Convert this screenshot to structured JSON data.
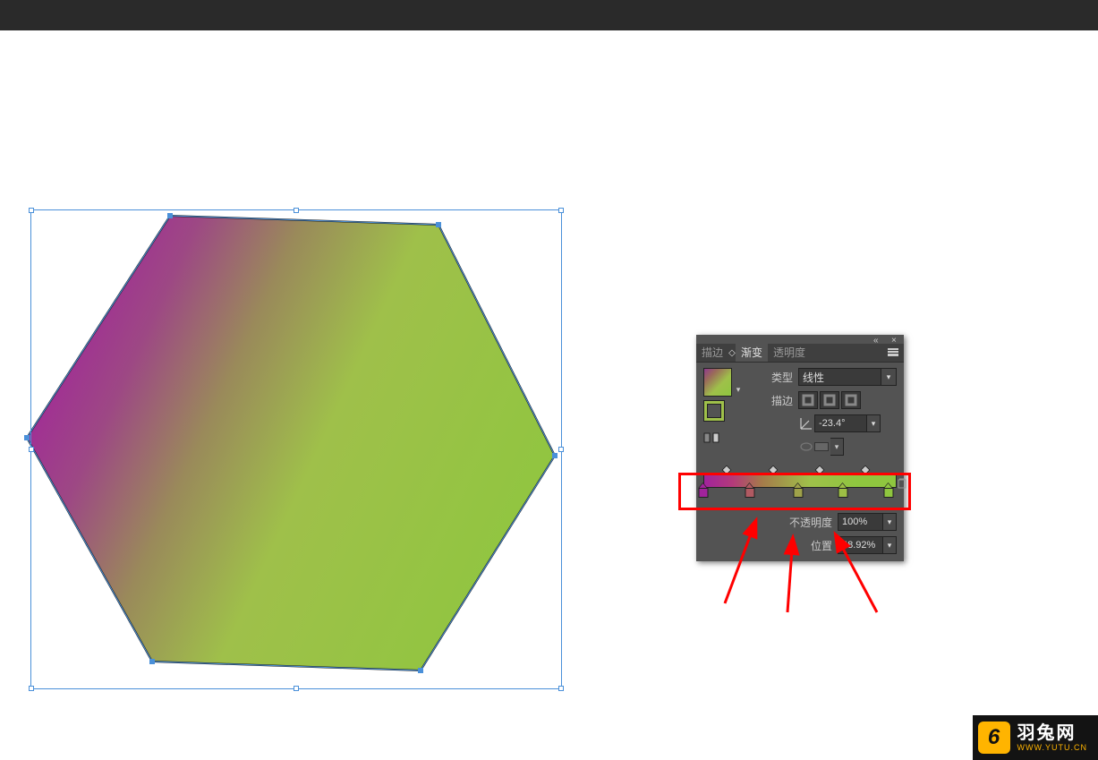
{
  "panel": {
    "tabs": {
      "stroke": "描边",
      "gradient": "渐变",
      "transparency": "透明度"
    },
    "type_label": "类型",
    "type_value": "线性",
    "stroke_label": "描边",
    "angle_value": "-23.4°",
    "opacity_label": "不透明度",
    "opacity_value": "100%",
    "position_label": "位置",
    "position_value": "48.92%",
    "gradient_stops": [
      {
        "pos": 0,
        "color": "#a2239c"
      },
      {
        "pos": 24,
        "color": "#b05a62"
      },
      {
        "pos": 48.9,
        "color": "#9fa24a"
      },
      {
        "pos": 72,
        "color": "#9dbf45"
      },
      {
        "pos": 96,
        "color": "#8fc63f"
      }
    ],
    "diamonds": [
      12,
      36,
      60,
      84
    ]
  },
  "watermark": {
    "icon": "6",
    "name": "羽兔网",
    "url": "WWW.YUTU.CN"
  },
  "chart_data": {
    "type": "gradient",
    "angle": -23.4,
    "stops": [
      {
        "pos": 0.0,
        "color": "#a2239c",
        "opacity": 1.0
      },
      {
        "pos": 0.24,
        "color": "#b05a62",
        "opacity": 1.0
      },
      {
        "pos": 0.489,
        "color": "#9fa24a",
        "opacity": 1.0
      },
      {
        "pos": 0.72,
        "color": "#9dbf45",
        "opacity": 1.0
      },
      {
        "pos": 0.96,
        "color": "#8fc63f",
        "opacity": 1.0
      }
    ],
    "opacity": 1.0,
    "selected_stop_position": 0.4892,
    "gradient_type": "linear"
  }
}
